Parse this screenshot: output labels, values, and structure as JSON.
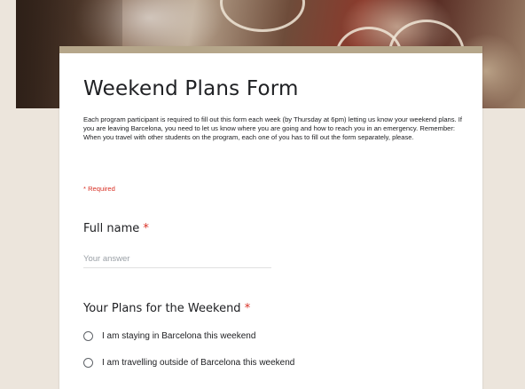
{
  "form": {
    "title": "Weekend Plans Form",
    "description": "Each program participant is required to fill out this form each week (by Thursday at 6pm) letting us know your weekend plans. If you are leaving Barcelona, you need to let us know where you are going and how to reach you in an emergency. Remember: When you travel with other students on the program, each one of you has to fill out the form separately, please.",
    "required_note": "* Required",
    "accent_color": "#b5a68a",
    "required_color": "#d93025"
  },
  "questions": {
    "full_name": {
      "title": "Full name",
      "asterisk": "*",
      "placeholder": "Your answer",
      "value": ""
    },
    "weekend_plans": {
      "title": "Your Plans for the Weekend",
      "asterisk": "*",
      "options": [
        {
          "label": "I am staying in Barcelona this weekend",
          "selected": false
        },
        {
          "label": "I am travelling outside of Barcelona this weekend",
          "selected": false
        }
      ]
    }
  }
}
